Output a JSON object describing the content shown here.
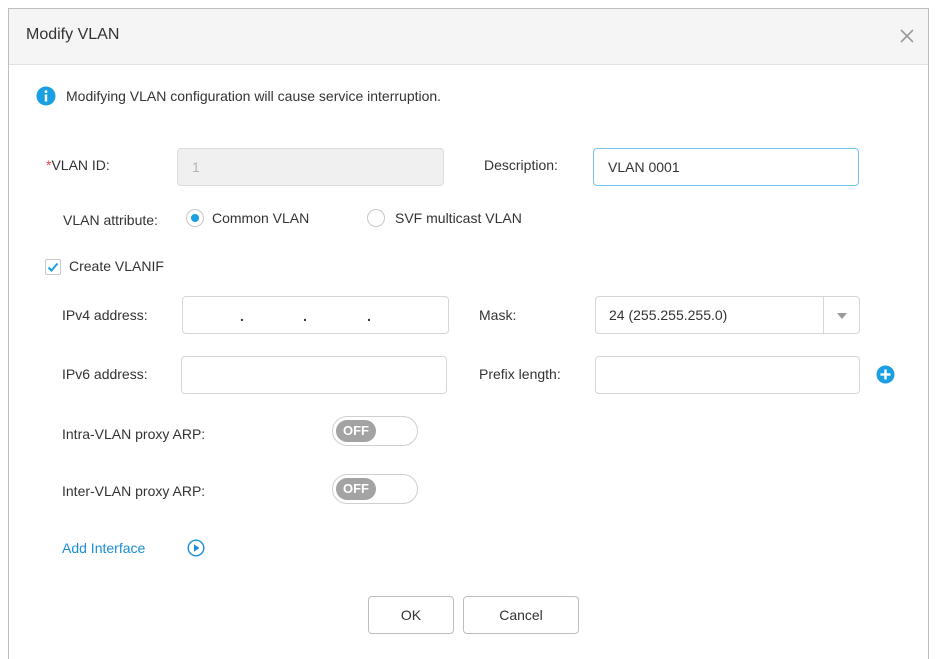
{
  "dialog": {
    "title": "Modify VLAN",
    "close_icon": "close-icon"
  },
  "notice": {
    "icon": "info-icon",
    "text": "Modifying VLAN configuration will cause service interruption."
  },
  "form": {
    "required_mark": "*",
    "vlan_id_label": "VLAN ID:",
    "vlan_id_value": "1",
    "description_label": "Description:",
    "description_value": "VLAN 0001",
    "vlan_attribute_label": "VLAN attribute:",
    "attr_option_common": "Common VLAN",
    "attr_option_svf": "SVF multicast VLAN",
    "attr_selected": "Common VLAN",
    "create_vlanif_label": "Create VLANIF",
    "create_vlanif_checked": true,
    "ipv4_label": "IPv4 address:",
    "ipv4_dot": ".",
    "mask_label": "Mask:",
    "mask_value": "24 (255.255.255.0)",
    "ipv6_label": "IPv6 address:",
    "prefix_label": "Prefix length:",
    "add_prefix_icon": "plus-circle-icon",
    "intra_arp_label": "Intra-VLAN proxy ARP:",
    "intra_arp_state": "OFF",
    "inter_arp_label": "Inter-VLAN proxy ARP:",
    "inter_arp_state": "OFF",
    "add_interface_label": "Add Interface",
    "add_interface_icon": "play-circle-icon"
  },
  "buttons": {
    "ok": "OK",
    "cancel": "Cancel"
  },
  "colors": {
    "accent": "#1aa0e2",
    "link": "#1a8fd8",
    "required": "#e8404a",
    "toggle_off": "#a3a3a3"
  }
}
